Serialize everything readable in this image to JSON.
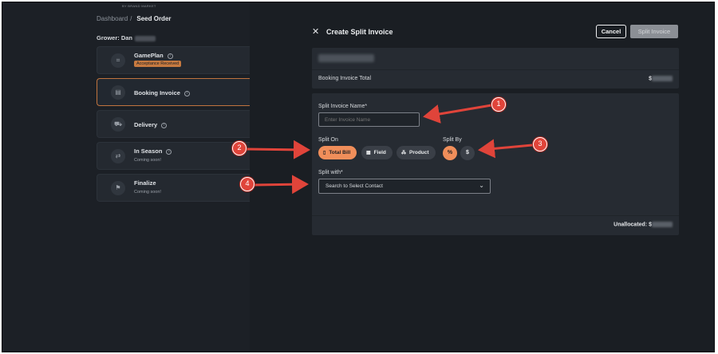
{
  "app": {
    "brand": "BY BRAND MARKET",
    "breadcrumb": {
      "root": "Dashboard",
      "separator": "/",
      "current": "Seed Order"
    },
    "grower_label": "Grower: Dan"
  },
  "steps": [
    {
      "title": "GamePlan",
      "badge": "Acceptance Received",
      "icon": "grid-icon"
    },
    {
      "title": "Booking Invoice",
      "icon": "document-icon",
      "active": true
    },
    {
      "title": "Delivery",
      "icon": "truck-icon"
    },
    {
      "title": "In Season",
      "subtitle": "Coming soon!",
      "icon": "refresh-icon"
    },
    {
      "title": "Finalize",
      "subtitle": "Coming soon!",
      "icon": "flag-icon"
    }
  ],
  "modal": {
    "title": "Create Split Invoice",
    "cancel_label": "Cancel",
    "split_label": "Split Invoice",
    "booking_total_label": "Booking Invoice Total",
    "currency": "$",
    "name_label": "Split Invoice Name*",
    "name_placeholder": "Enter Invoice Name",
    "split_on_label": "Split On",
    "split_on_options": [
      "Total Bill",
      "Field",
      "Product"
    ],
    "split_on_selected": "Total Bill",
    "split_by_label": "Split By",
    "split_by_options": [
      "%",
      "$"
    ],
    "split_by_selected": "%",
    "split_with_label": "Split with*",
    "split_with_value": "Search to Select Contact",
    "unallocated_label": "Unallocated: $"
  },
  "callouts": [
    "1",
    "2",
    "3",
    "4"
  ],
  "colors": {
    "accent": "#f08e5a",
    "callout": "#e0443a",
    "badge": "#c77a40"
  }
}
